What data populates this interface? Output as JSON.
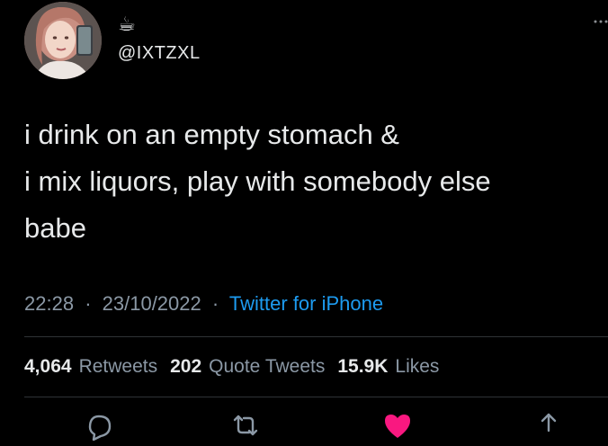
{
  "user": {
    "emoji": "☕",
    "handle": "@IXTZXL"
  },
  "tweet": {
    "lines": [
      "i drink on an empty stomach &",
      "i mix liquors, play with somebody else",
      "babe"
    ],
    "time": "22:28",
    "date": "23/10/2022",
    "source": "Twitter for iPhone",
    "separator": "·"
  },
  "stats": {
    "retweets_count": "4,064",
    "retweets_label": "Retweets",
    "quotes_count": "202",
    "quotes_label": "Quote Tweets",
    "likes_count": "15.9K",
    "likes_label": "Likes"
  },
  "icons": {
    "more": "more-icon",
    "reply": "reply-icon",
    "retweet": "retweet-icon",
    "like": "heart-icon",
    "share": "share-icon"
  },
  "colors": {
    "background": "#000000",
    "text": "#e7e9ea",
    "muted": "#8b98a5",
    "link": "#1d9bf0",
    "like": "#f91880"
  }
}
